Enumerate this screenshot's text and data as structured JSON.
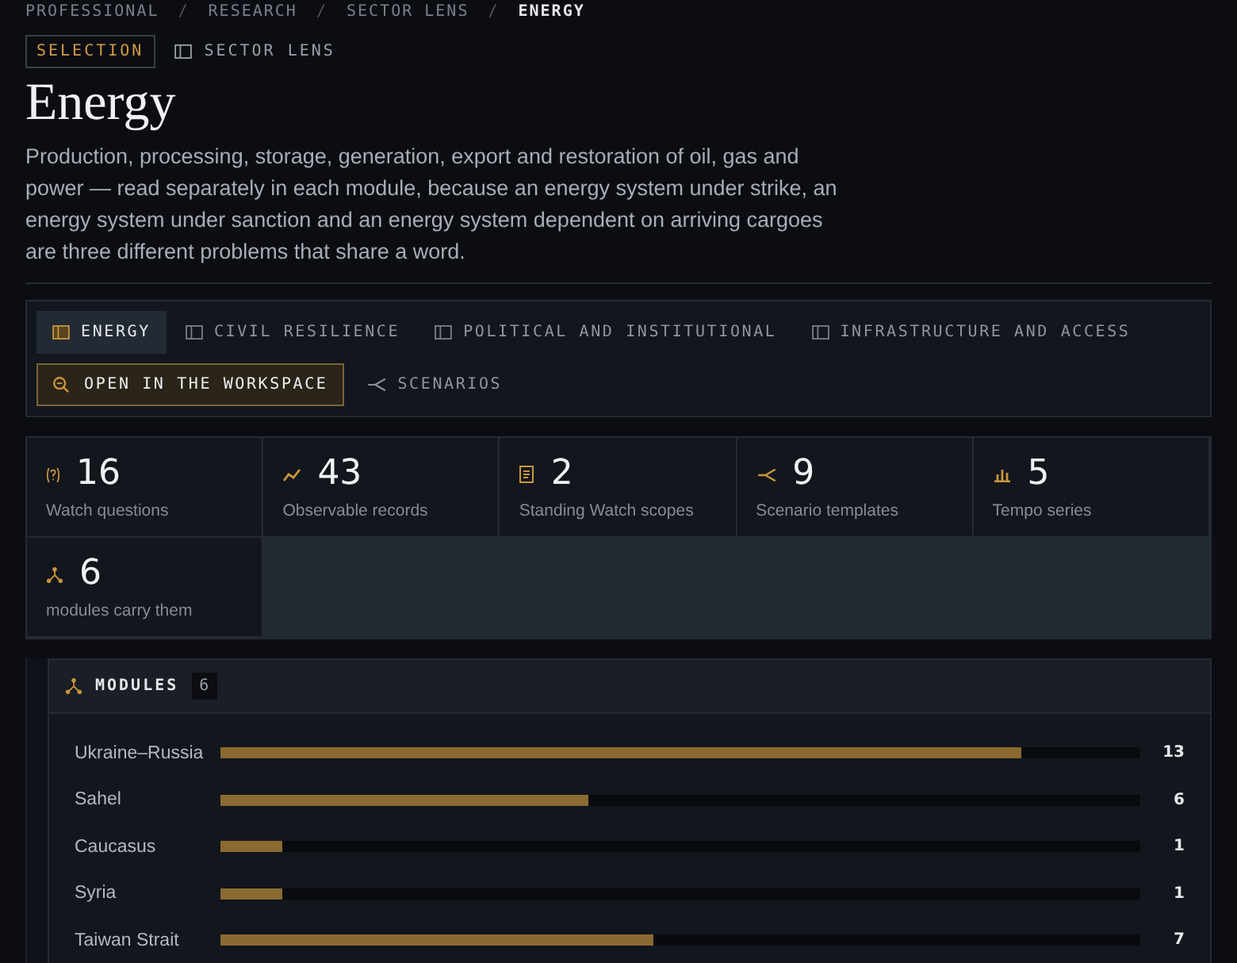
{
  "breadcrumb": [
    {
      "label": "PROFESSIONAL",
      "current": false
    },
    {
      "label": "RESEARCH",
      "current": false
    },
    {
      "label": "SECTOR LENS",
      "current": false
    },
    {
      "label": "ENERGY",
      "current": true
    }
  ],
  "breadcrumb_separator": "/",
  "badge": "SELECTION",
  "lens_label": "SECTOR LENS",
  "title": "Energy",
  "description": "Production, processing, storage, generation, export and restoration of oil, gas and power — read separately in each module, because an energy system under strike, an energy system under sanction and an energy system dependent on arriving cargoes are three different problems that share a word.",
  "tabs": [
    {
      "label": "ENERGY",
      "selected": true
    },
    {
      "label": "CIVIL RESILIENCE",
      "selected": false
    },
    {
      "label": "POLITICAL AND INSTITUTIONAL",
      "selected": false
    },
    {
      "label": "INFRASTRUCTURE AND ACCESS",
      "selected": false
    }
  ],
  "actions": [
    {
      "label": "OPEN IN THE WORKSPACE",
      "kind": "primary"
    },
    {
      "label": "SCENARIOS",
      "kind": "link"
    }
  ],
  "stats": [
    {
      "kind": "question",
      "value": "16",
      "label": "Watch questions"
    },
    {
      "kind": "trend",
      "value": "43",
      "label": "Observable records"
    },
    {
      "kind": "doc",
      "value": "2",
      "label": "Standing Watch scopes"
    },
    {
      "kind": "branch",
      "value": "9",
      "label": "Scenario templates"
    },
    {
      "kind": "bars",
      "value": "5",
      "label": "Tempo series"
    },
    {
      "kind": "nodes",
      "value": "6",
      "label": "modules carry them"
    }
  ],
  "modules": {
    "title": "MODULES",
    "count": "6",
    "rows": [
      {
        "name": "Ukraine–Russia",
        "level": 0.87,
        "value": "13"
      },
      {
        "name": "Sahel",
        "level": 0.4,
        "value": "6"
      },
      {
        "name": "Caucasus",
        "level": 0.068,
        "value": "1"
      },
      {
        "name": "Syria",
        "level": 0.068,
        "value": "1"
      },
      {
        "name": "Taiwan Strait",
        "level": 0.47,
        "value": "7"
      }
    ]
  }
}
